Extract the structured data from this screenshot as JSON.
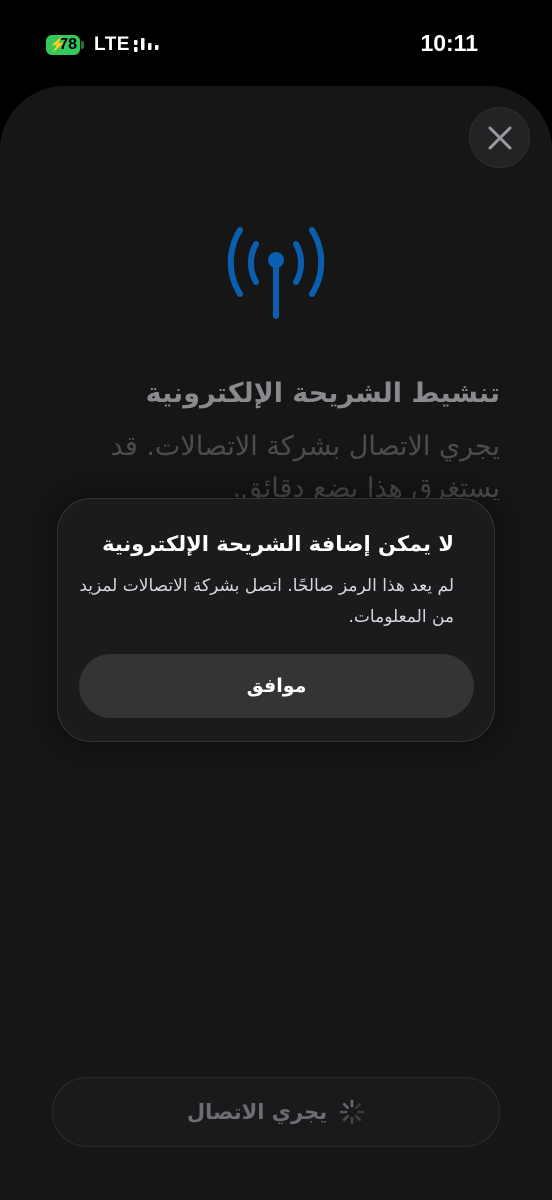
{
  "status_bar": {
    "battery_level": "78",
    "network": "LTE",
    "time": "10:11"
  },
  "sheet": {
    "title": "تنشيط الشريحة الإلكترونية",
    "body": "يجري الاتصال بشركة الاتصالات. قد يستغرق هذا بضع دقائق."
  },
  "dialog": {
    "title": "لا يمكن إضافة الشريحة الإلكترونية",
    "message": "لم يعد هذا الرمز صالحًا. اتصل بشركة الاتصالات لمزيد من المعلومات.",
    "ok_label": "موافق"
  },
  "bottom_button": {
    "label": "يجري الاتصال"
  },
  "colors": {
    "accent_blue": "#0a5fb0",
    "battery_green": "#34c759"
  },
  "icons": {
    "close": "close-icon",
    "antenna": "antenna-icon",
    "spinner": "spinner-icon"
  }
}
